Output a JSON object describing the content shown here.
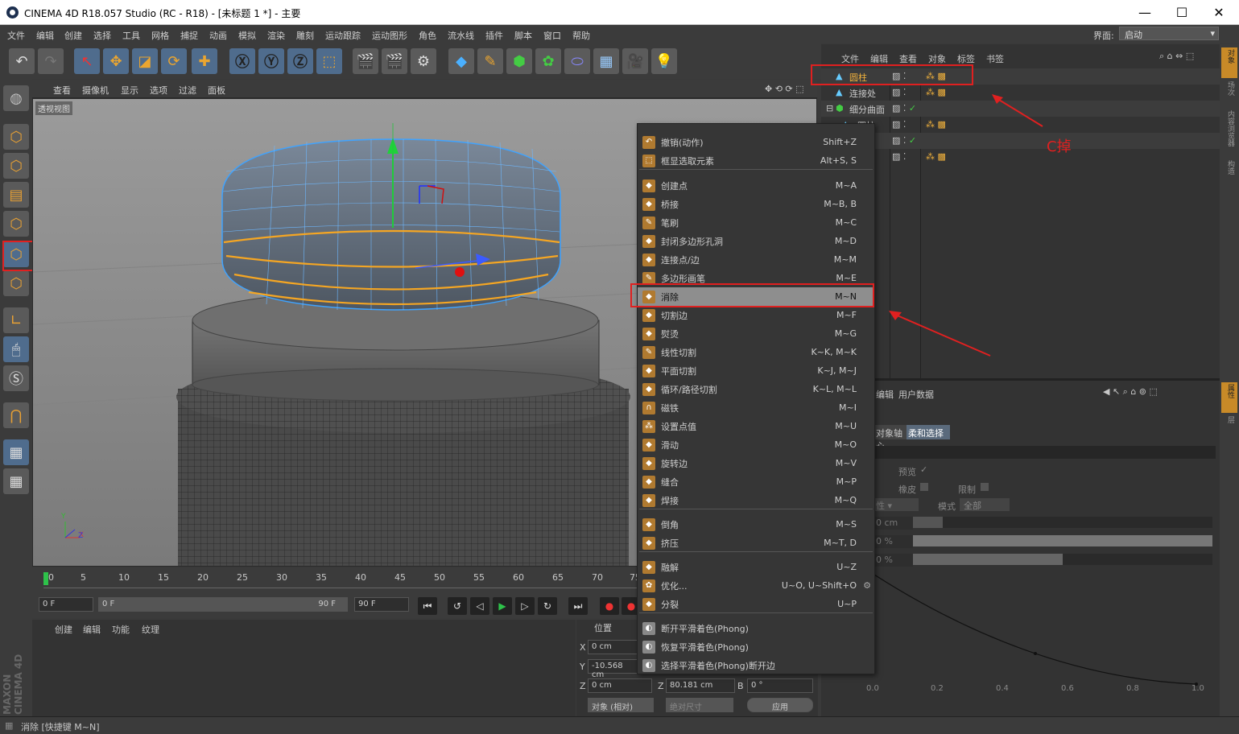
{
  "window": {
    "title": "CINEMA 4D R18.057 Studio (RC - R18) - [未标题 1 *] - 主要",
    "minimize": "—",
    "maximize": "☐",
    "close": "✕"
  },
  "menubar": [
    "文件",
    "编辑",
    "创建",
    "选择",
    "工具",
    "网格",
    "捕捉",
    "动画",
    "模拟",
    "渲染",
    "雕刻",
    "运动跟踪",
    "运动图形",
    "角色",
    "流水线",
    "插件",
    "脚本",
    "窗口",
    "帮助"
  ],
  "layout": {
    "label": "界面:",
    "value": "启动"
  },
  "viewport": {
    "menu": [
      "查看",
      "摄像机",
      "显示",
      "选项",
      "过滤",
      "面板"
    ],
    "label": "透视视图"
  },
  "timeline": {
    "ticks": [
      "0",
      "5",
      "10",
      "15",
      "20",
      "25",
      "30",
      "35",
      "40",
      "45",
      "50",
      "55",
      "60",
      "65",
      "70",
      "75"
    ]
  },
  "transport": {
    "start": "0 F",
    "range_start": "0 F",
    "range_end": "90 F",
    "end": "90 F"
  },
  "material": {
    "menu": [
      "创建",
      "编辑",
      "功能",
      "纹理"
    ]
  },
  "coords": {
    "header": "位置",
    "x_label": "X",
    "x": "0 cm",
    "y_label": "Y",
    "y": "-10.568 cm",
    "z_label": "Z",
    "z": "0 cm",
    "z2_label": "Z",
    "z2": "80.181 cm",
    "b_label": "B",
    "b": "0 °",
    "mode": "对象 (相对)",
    "size": "绝对尺寸",
    "apply": "应用"
  },
  "objects": {
    "menu": [
      "文件",
      "编辑",
      "查看",
      "对象",
      "标签",
      "书签"
    ],
    "items": [
      "圆柱",
      "连接处",
      "细分曲面",
      "圆柱"
    ]
  },
  "annotation": "C掉",
  "attributes": {
    "menu": [
      "编辑",
      "用户数据"
    ],
    "tabs": [
      "对象轴心",
      "柔和选择"
    ],
    "preview": "预览",
    "rubber": "橡皮",
    "limit": "限制",
    "mode_label": "模式",
    "mode_value": "全部",
    "radius": "0 cm",
    "strength": "0 %",
    "width": "0 %",
    "axis": [
      "0.0",
      "0.2",
      "0.4",
      "0.6",
      "0.8",
      "1.0"
    ]
  },
  "context_menu": [
    {
      "label": "撤销(动作)",
      "shortcut": "Shift+Z"
    },
    {
      "label": "框显选取元素",
      "shortcut": "Alt+S, S"
    },
    {
      "label": "创建点",
      "shortcut": "M~A"
    },
    {
      "label": "桥接",
      "shortcut": "M~B, B"
    },
    {
      "label": "笔刷",
      "shortcut": "M~C"
    },
    {
      "label": "封闭多边形孔洞",
      "shortcut": "M~D"
    },
    {
      "label": "连接点/边",
      "shortcut": "M~M"
    },
    {
      "label": "多边形画笔",
      "shortcut": "M~E"
    },
    {
      "label": "消除",
      "shortcut": "M~N"
    },
    {
      "label": "切割边",
      "shortcut": "M~F"
    },
    {
      "label": "熨烫",
      "shortcut": "M~G"
    },
    {
      "label": "线性切割",
      "shortcut": "K~K, M~K"
    },
    {
      "label": "平面切割",
      "shortcut": "K~J, M~J"
    },
    {
      "label": "循环/路径切割",
      "shortcut": "K~L, M~L"
    },
    {
      "label": "磁铁",
      "shortcut": "M~I"
    },
    {
      "label": "设置点值",
      "shortcut": "M~U"
    },
    {
      "label": "滑动",
      "shortcut": "M~O"
    },
    {
      "label": "旋转边",
      "shortcut": "M~V"
    },
    {
      "label": "缝合",
      "shortcut": "M~P"
    },
    {
      "label": "焊接",
      "shortcut": "M~Q"
    },
    {
      "label": "倒角",
      "shortcut": "M~S"
    },
    {
      "label": "挤压",
      "shortcut": "M~T, D"
    },
    {
      "label": "融解",
      "shortcut": "U~Z"
    },
    {
      "label": "优化...",
      "shortcut": "U~O, U~Shift+O"
    },
    {
      "label": "分裂",
      "shortcut": "U~P"
    },
    {
      "label": "断开平滑着色(Phong)",
      "shortcut": ""
    },
    {
      "label": "恢复平滑着色(Phong)",
      "shortcut": ""
    },
    {
      "label": "选择平滑着色(Phong)断开边",
      "shortcut": ""
    }
  ],
  "right_tabs": [
    "对象",
    "场次",
    "内容浏览器",
    "构造",
    "属性",
    "层"
  ],
  "brand": "MAXON CINEMA 4D",
  "status": "消除 [快捷键 M~N]"
}
